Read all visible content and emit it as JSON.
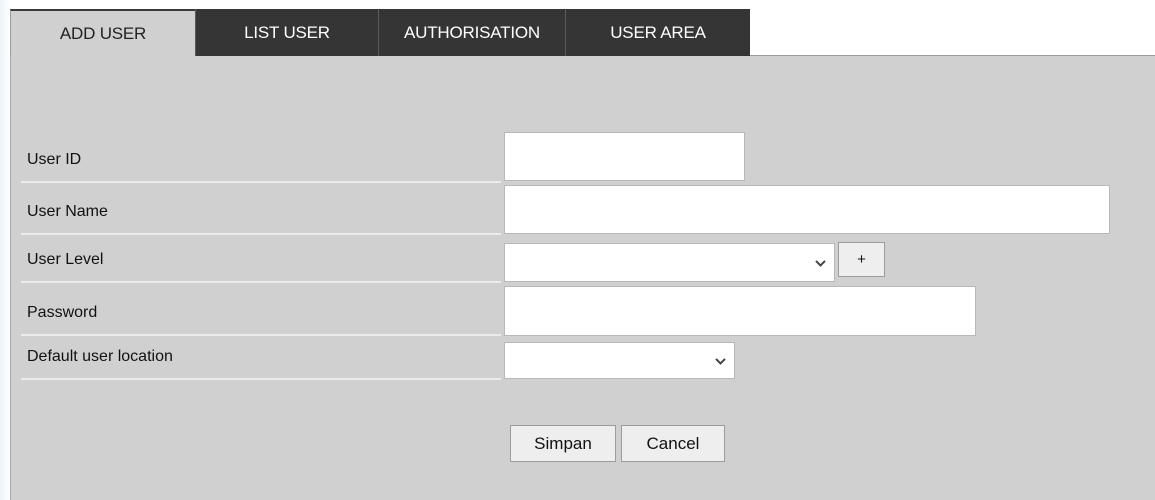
{
  "tabs": [
    {
      "label": "ADD USER",
      "active": true
    },
    {
      "label": "LIST USER",
      "active": false
    },
    {
      "label": "AUTHORISATION",
      "active": false
    },
    {
      "label": "USER AREA",
      "active": false
    }
  ],
  "form": {
    "user_id": {
      "label": "User ID",
      "value": ""
    },
    "user_name": {
      "label": "User Name",
      "value": ""
    },
    "user_level": {
      "label": "User Level",
      "value": "",
      "add_label": "+"
    },
    "password": {
      "label": "Password",
      "value": ""
    },
    "default_location": {
      "label": "Default user location",
      "value": ""
    }
  },
  "buttons": {
    "save_label": "Simpan",
    "cancel_label": "Cancel"
  },
  "colors": {
    "panel_bg": "#d0d0d0",
    "tab_dark_bg": "#353535",
    "tab_active_text": "#222222",
    "tab_dark_text": "#ffffff"
  }
}
